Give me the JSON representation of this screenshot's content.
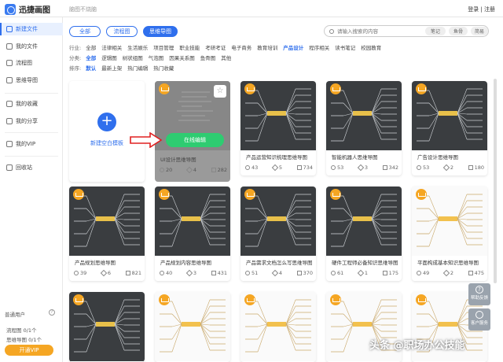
{
  "app": {
    "name": "迅捷画图",
    "doc_title": "脑图不烧脑",
    "login": "登录 | 注册"
  },
  "sidebar": {
    "items": [
      {
        "label": "新建文件",
        "icon": "file-plus-icon"
      },
      {
        "label": "我的文件",
        "icon": "folder-icon"
      },
      {
        "label": "流程图",
        "icon": "flowchart-icon"
      },
      {
        "label": "思维导图",
        "icon": "mindmap-icon"
      },
      {
        "label": "我的收藏",
        "icon": "star-icon"
      },
      {
        "label": "我的分享",
        "icon": "share-icon"
      },
      {
        "label": "我的VIP",
        "icon": "vip-icon"
      },
      {
        "label": "回收站",
        "icon": "trash-icon"
      }
    ],
    "plan_title": "普通用户",
    "quota_flow": "流程图 0/1个",
    "quota_mind": "思维导图 0/1个",
    "vip_button": "开通VIP"
  },
  "type_tabs": [
    "全部",
    "流程图",
    "思维导图"
  ],
  "search": {
    "placeholder": "请输入搜索的内容",
    "chips": [
      "笔记",
      "鱼骨",
      "简易"
    ]
  },
  "filters": {
    "industry": {
      "label": "行业:",
      "options": [
        "全部",
        "法律相关",
        "生活娱乐",
        "项目管理",
        "职业技能",
        "考研考证",
        "电子商务",
        "教育培训",
        "产品设计",
        "程序相关",
        "读书笔记",
        "校园教育"
      ],
      "selected": 8
    },
    "category": {
      "label": "分类:",
      "options": [
        "全部",
        "逻辑图",
        "树状组图",
        "气泡图",
        "因果关系图",
        "鱼骨图",
        "其他"
      ],
      "selected": 0
    },
    "sort": {
      "label": "排序:",
      "options": [
        "默认",
        "最新上架",
        "热门编辑",
        "热门收藏"
      ],
      "selected": 0
    }
  },
  "new_template": {
    "label": "新建空白模板"
  },
  "hover_card": {
    "title": "UI设计思维导图",
    "views": "20",
    "stars": "4",
    "edits": "282",
    "edit_button": "在线编辑"
  },
  "cards": [
    {
      "title": "产品运营知识梳理思维导图",
      "views": "43",
      "stars": "5",
      "edits": "734",
      "dark": true
    },
    {
      "title": "智能机器人思维导图",
      "views": "53",
      "stars": "3",
      "edits": "342",
      "dark": true
    },
    {
      "title": "广告设计思维导图",
      "views": "53",
      "stars": "2",
      "edits": "180",
      "dark": true
    },
    {
      "title": "产品规划思维导图",
      "views": "39",
      "stars": "6",
      "edits": "821",
      "dark": true
    },
    {
      "title": "产品规划内容思维导图",
      "views": "40",
      "stars": "3",
      "edits": "431",
      "dark": true
    },
    {
      "title": "产品需求文档怎么写思维导图",
      "views": "51",
      "stars": "4",
      "edits": "370",
      "dark": true
    },
    {
      "title": "硬件工程师必备知识思维导图",
      "views": "61",
      "stars": "1",
      "edits": "175",
      "dark": true
    },
    {
      "title": "平面构成基本知识思维导图",
      "views": "49",
      "stars": "2",
      "edits": "475",
      "dark": false
    },
    {
      "title": "",
      "views": "",
      "stars": "",
      "edits": "",
      "dark": true
    },
    {
      "title": "",
      "views": "",
      "stars": "",
      "edits": "",
      "dark": false
    },
    {
      "title": "",
      "views": "",
      "stars": "",
      "edits": "",
      "dark": false
    },
    {
      "title": "",
      "views": "",
      "stars": "",
      "edits": "",
      "dark": false
    },
    {
      "title": "",
      "views": "",
      "stars": "",
      "edits": "",
      "dark": false
    }
  ],
  "float_buttons": [
    "帮助反馈",
    "客户服务"
  ],
  "watermark": "头条 @职场办公技能",
  "colors": {
    "accent": "#2f6fed",
    "edit_green": "#2ecc71",
    "vip_orange": "#f5a623",
    "arrow_red": "#e02020"
  }
}
